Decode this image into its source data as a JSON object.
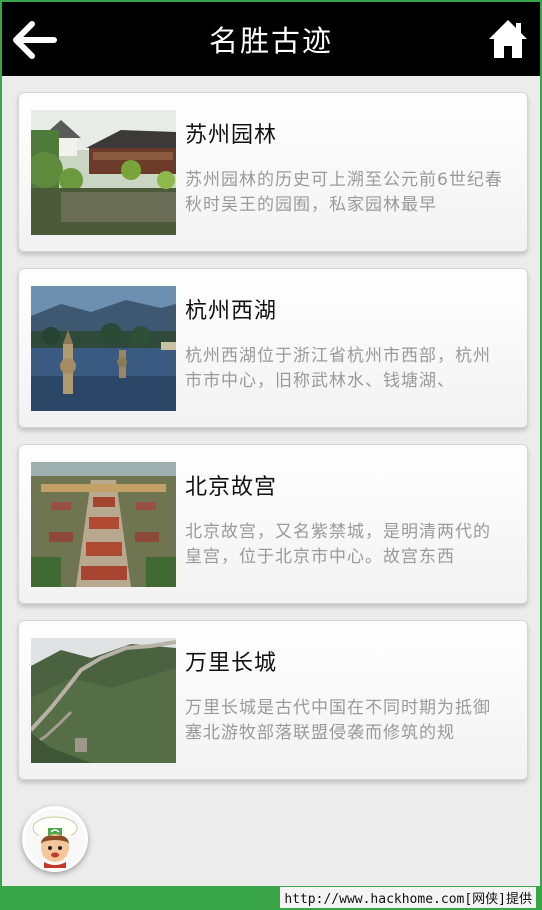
{
  "header": {
    "title": "名胜古迹",
    "back_icon": "back-arrow-icon",
    "home_icon": "home-icon"
  },
  "items": [
    {
      "name": "苏州园林",
      "desc": "苏州园林的历史可上溯至公元前6世纪春秋时吴王的园囿，私家园林最早",
      "image": "suzhou-garden-photo"
    },
    {
      "name": "杭州西湖",
      "desc": "杭州西湖位于浙江省杭州市西部，杭州市市中心，旧称武林水、钱塘湖、",
      "image": "west-lake-photo"
    },
    {
      "name": "北京故宫",
      "desc": "北京故宫，又名紫禁城，是明清两代的皇宫，位于北京市中心。故宫东西",
      "image": "forbidden-city-photo"
    },
    {
      "name": "万里长城",
      "desc": "万里长城是古代中国在不同时期为抵御塞北游牧部落联盟侵袭而修筑的规",
      "image": "great-wall-photo"
    }
  ],
  "mascot": {
    "icon": "chef-mascot-icon"
  },
  "footer": {
    "watermark": "http://www.hackhome.com[网侠]提供"
  },
  "colors": {
    "header_bg": "#000000",
    "accent_green": "#3aa64a",
    "background": "#ececec",
    "desc_text": "#9a9a9a"
  }
}
